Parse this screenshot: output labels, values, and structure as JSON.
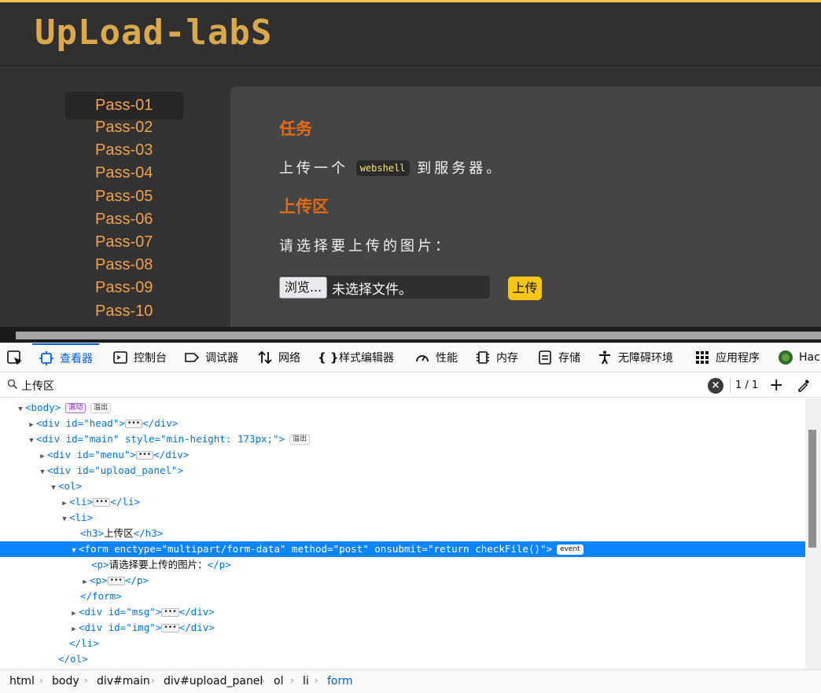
{
  "site": {
    "logo": "UpLoad-labS",
    "menu": [
      "Pass-01",
      "Pass-02",
      "Pass-03",
      "Pass-04",
      "Pass-05",
      "Pass-06",
      "Pass-07",
      "Pass-08",
      "Pass-09",
      "Pass-10"
    ],
    "panel": {
      "task_heading": "任务",
      "task_text_before": "上传一个",
      "task_code": "webshell",
      "task_text_after": "到服务器。",
      "upload_heading": "上传区",
      "select_prompt": "请选择要上传的图片：",
      "browse_label": "浏览...",
      "file_status": "未选择文件。",
      "upload_button": "上传"
    },
    "colors": {
      "accent_orange": "#e56a14",
      "menu_orange": "#f2a04a",
      "upload_yellow": "#f5c518",
      "bg_dark": "#333333"
    }
  },
  "devtools": {
    "tabs": [
      {
        "icon": "inspector-icon",
        "label": "查看器",
        "active": true
      },
      {
        "icon": "console-icon",
        "label": "控制台"
      },
      {
        "icon": "debugger-icon",
        "label": "调试器"
      },
      {
        "icon": "network-icon",
        "label": "网络"
      },
      {
        "icon": "style-editor-icon",
        "label": "样式编辑器"
      },
      {
        "icon": "performance-icon",
        "label": "性能"
      },
      {
        "icon": "memory-icon",
        "label": "内存"
      },
      {
        "icon": "storage-icon",
        "label": "存储"
      },
      {
        "icon": "accessibility-icon",
        "label": "无障碍环境"
      },
      {
        "icon": "application-icon",
        "label": "应用程序"
      },
      {
        "icon": "hackbar-icon",
        "label": "Hac"
      }
    ],
    "search": {
      "value": "上传区",
      "count": "1 / 1"
    },
    "badges": {
      "scroll": "滚动",
      "overflow": "溢出",
      "event": "event"
    },
    "markup": {
      "body_open": "<body>",
      "head_div_open": "<div id=\"head\">",
      "div_close": "</div>",
      "main_open_prefix": "<div id=\"main\" style=\"min-height: 173px;\">",
      "menu_div_open": "<div id=\"menu\">",
      "upload_panel_open": "<div id=\"upload_panel\">",
      "ol_open": "<ol>",
      "li_open": "<li>",
      "li_close": "</li>",
      "h3_open": "<h3>",
      "h3_text": "上传区",
      "h3_close": "</h3>",
      "form_open": "<form enctype=\"multipart/form-data\" method=\"post\" onsubmit=\"return checkFile()\">",
      "p_open": "<p>",
      "p_text": "请选择要上传的图片：",
      "p_close": "</p>",
      "form_close": "</form>",
      "msg_div_open": "<div id=\"msg\">",
      "img_div_open": "<div id=\"img\">",
      "ol_close": "</ol>",
      "dots": "•••"
    },
    "breadcrumbs": [
      "html",
      "body",
      "div#main",
      "div#upload_panel",
      "ol",
      "li",
      "form"
    ]
  }
}
